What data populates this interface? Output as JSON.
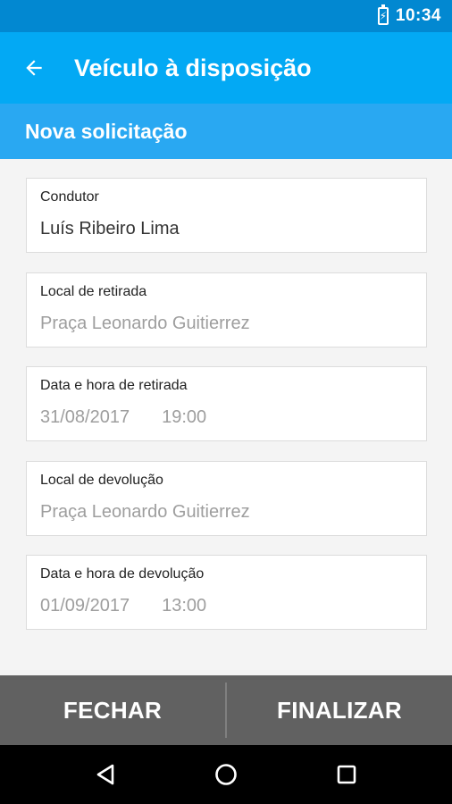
{
  "status_bar": {
    "time": "10:34",
    "battery_icon": "battery-charging-icon"
  },
  "app_bar": {
    "title": "Veículo à disposição",
    "back_icon": "arrow-back-icon"
  },
  "sub_header": {
    "title": "Nova solicitação"
  },
  "fields": [
    {
      "label": "Condutor",
      "value": "Luís Ribeiro Lima"
    },
    {
      "label": "Local de retirada",
      "placeholder": "Praça Leonardo Guitierrez"
    },
    {
      "label": "Data e hora de retirada",
      "date_placeholder": "31/08/2017",
      "time_placeholder": "19:00"
    },
    {
      "label": "Local de devolução",
      "placeholder": "Praça Leonardo Guitierrez"
    },
    {
      "label": "Data e hora de devolução",
      "date_placeholder": "01/09/2017",
      "time_placeholder": "13:00"
    }
  ],
  "actions": {
    "close_label": "FECHAR",
    "finish_label": "FINALIZAR"
  },
  "nav_bar": {
    "back_icon": "nav-back-icon",
    "home_icon": "nav-home-icon",
    "recents_icon": "nav-recents-icon"
  },
  "colors": {
    "status_bar": "#0288d1",
    "app_bar": "#03a9f4",
    "sub_header": "#29a8f2",
    "action_bar": "#616161",
    "hint_text": "#9e9e9e"
  }
}
